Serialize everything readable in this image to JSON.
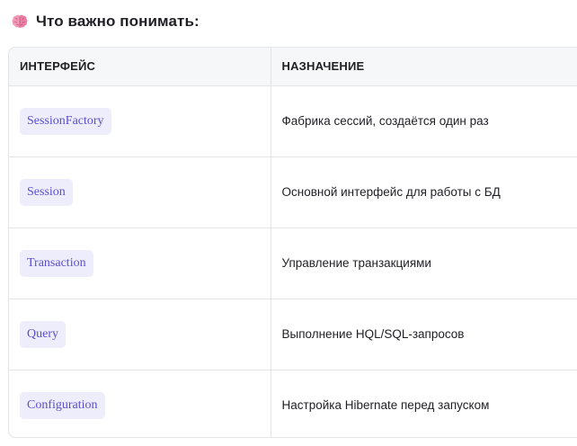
{
  "heading": {
    "icon": "brain-icon",
    "text": "Что важно понимать:"
  },
  "table": {
    "headers": [
      "ИНТЕРФЕЙС",
      "НАЗНАЧЕНИЕ"
    ],
    "rows": [
      {
        "interface": "SessionFactory",
        "purpose": "Фабрика сессий, создаётся один раз"
      },
      {
        "interface": "Session",
        "purpose": "Основной интерфейс для работы с БД"
      },
      {
        "interface": "Transaction",
        "purpose": "Управление транзакциями"
      },
      {
        "interface": "Query",
        "purpose": "Выполнение HQL/SQL-запросов"
      },
      {
        "interface": "Configuration",
        "purpose": "Настройка Hibernate перед запуском"
      }
    ]
  },
  "colors": {
    "chip_bg": "#eeedfb",
    "chip_text": "#5b4fd0",
    "border": "#e3e3e8",
    "header_bg": "#f6f7f9",
    "brain": "#f08fb0"
  }
}
